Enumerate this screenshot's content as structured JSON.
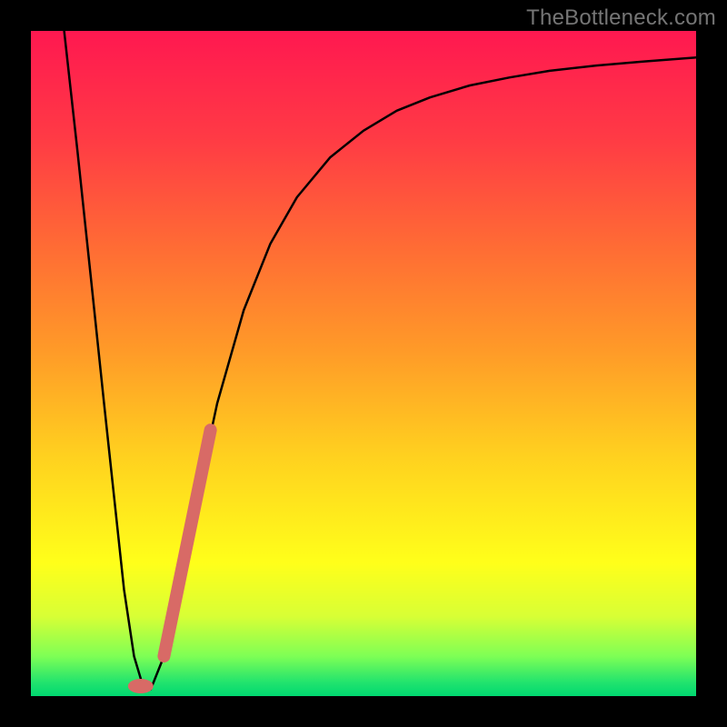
{
  "watermark": "TheBottleneck.com",
  "colors": {
    "frame": "#000000",
    "curve": "#000000",
    "overlay_stroke": "#d86a66",
    "gradient_top": "#ff1850",
    "gradient_bottom": "#00d870"
  },
  "chart_data": {
    "type": "line",
    "title": "",
    "xlabel": "",
    "ylabel": "",
    "xlim": [
      0,
      100
    ],
    "ylim": [
      0,
      100
    ],
    "grid": false,
    "legend": false,
    "series": [
      {
        "name": "bottleneck-curve",
        "x": [
          5,
          7,
          9,
          11,
          12.5,
          14,
          15.5,
          17,
          18,
          20,
          22,
          25,
          28,
          32,
          36,
          40,
          45,
          50,
          55,
          60,
          66,
          72,
          78,
          85,
          92,
          100
        ],
        "y": [
          100,
          82,
          63,
          44,
          30,
          16,
          6,
          1,
          1,
          6,
          16,
          30,
          44,
          58,
          68,
          75,
          81,
          85,
          88,
          90,
          91.8,
          93,
          94,
          94.8,
          95.4,
          96
        ]
      }
    ],
    "overlay_segment": {
      "name": "highlighted-range",
      "x": [
        20,
        27
      ],
      "y": [
        6,
        40
      ]
    },
    "overlay_point": {
      "name": "min-marker",
      "x": 16.5,
      "y": 1.5
    },
    "notes": "y-values read from gradient position (0 = bottom/green, 100 = top/red). Curve is a V starting at x≈5 y=100 dropping to near y=0 at x≈17 then asymptotically rising; x-axis unlabeled so treated as 0–100."
  }
}
